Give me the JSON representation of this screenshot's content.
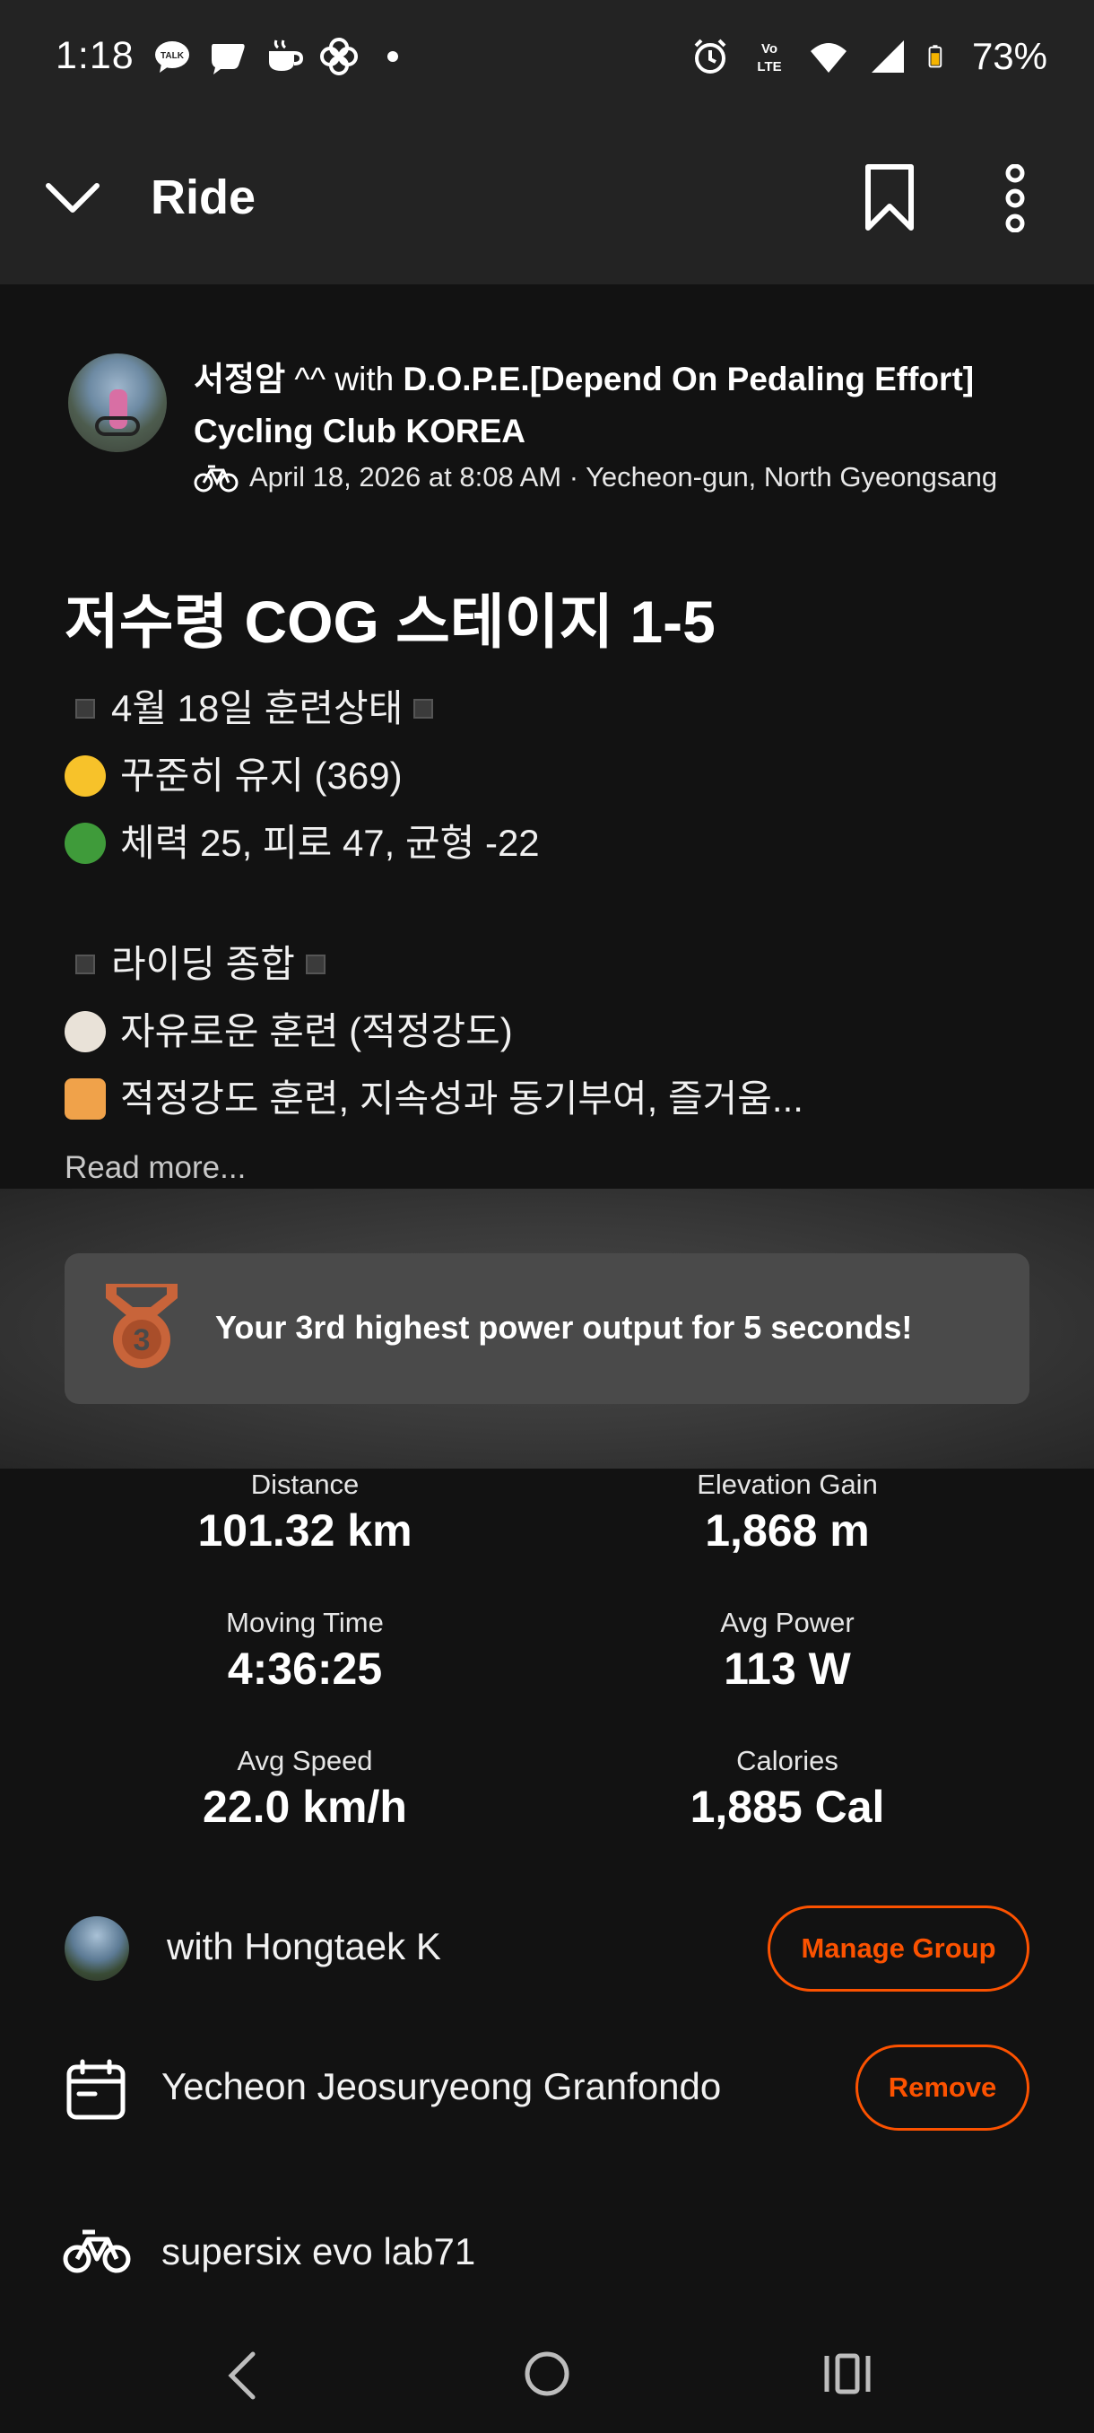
{
  "status_bar": {
    "time": "1:18",
    "battery": "73%",
    "icons": [
      "talk-icon",
      "chat-icon",
      "cafe-icon",
      "pinwheel-icon",
      "alarm-icon",
      "volte-icon",
      "wifi-icon",
      "signal-icon",
      "battery-icon"
    ]
  },
  "app_bar": {
    "title": "Ride"
  },
  "activity": {
    "author": "서정암",
    "author_suffix": " ^^ with ",
    "club": "D.O.P.E.[Depend On Pedaling Effort] Cycling Club KOREA",
    "meta": "April 18, 2026 at 8:08 AM · Yecheon-gun, North Gyeongsang",
    "title": "저수령 COG 스테이지 1-5",
    "description": {
      "section1_header": "4월 18일 훈련상태",
      "line1": "꾸준히 유지 (369)",
      "line2": "체력 25, 피로 47, 균형 -22",
      "section2_header": "라이딩 종합",
      "line3": "자유로운 훈련 (적정강도)",
      "line4": "적정강도 훈련, 지속성과 동기부여, 즐거움..."
    },
    "read_more": "Read more..."
  },
  "achievement": {
    "rank": "3",
    "text": "Your 3rd highest power output for 5 seconds!",
    "medal_color": "#c8643a"
  },
  "stats": {
    "distance_label": "Distance",
    "distance_value": "101.32 km",
    "elevation_label": "Elevation Gain",
    "elevation_value": "1,868 m",
    "moving_time_label": "Moving Time",
    "moving_time_value": "4:36:25",
    "avg_power_label": "Avg Power",
    "avg_power_value": "113 W",
    "avg_speed_label": "Avg Speed",
    "avg_speed_value": "22.0 km/h",
    "calories_label": "Calories",
    "calories_value": "1,885 Cal"
  },
  "group": {
    "text": "with Hongtaek K",
    "button": "Manage Group"
  },
  "event": {
    "text": "Yecheon Jeosuryeong Granfondo",
    "button": "Remove"
  },
  "gear": {
    "text": "supersix evo lab71"
  },
  "colors": {
    "accent": "#fc5200",
    "background": "#121212",
    "bar": "#232323"
  }
}
